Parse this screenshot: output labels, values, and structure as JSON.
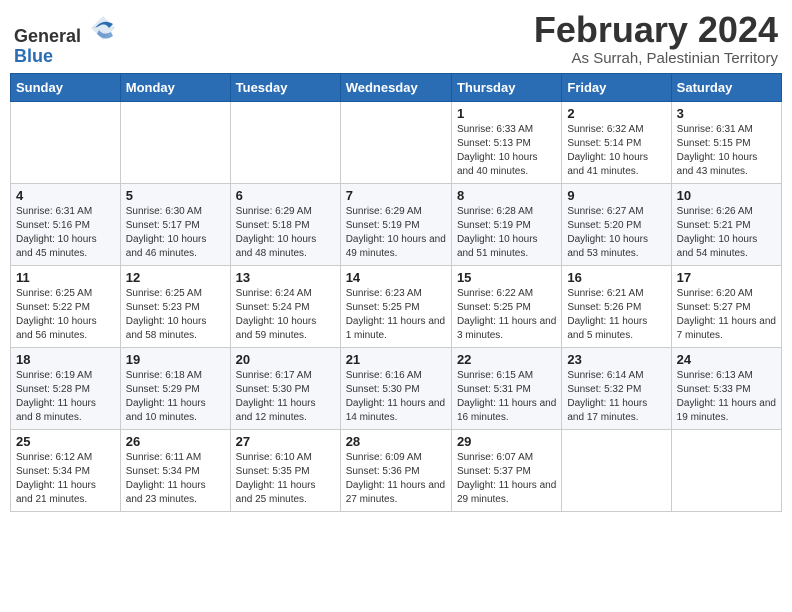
{
  "logo": {
    "general": "General",
    "blue": "Blue"
  },
  "header": {
    "month": "February 2024",
    "location": "As Surrah, Palestinian Territory"
  },
  "days_of_week": [
    "Sunday",
    "Monday",
    "Tuesday",
    "Wednesday",
    "Thursday",
    "Friday",
    "Saturday"
  ],
  "weeks": [
    [
      {
        "day": "",
        "sunrise": "",
        "sunset": "",
        "daylight": ""
      },
      {
        "day": "",
        "sunrise": "",
        "sunset": "",
        "daylight": ""
      },
      {
        "day": "",
        "sunrise": "",
        "sunset": "",
        "daylight": ""
      },
      {
        "day": "",
        "sunrise": "",
        "sunset": "",
        "daylight": ""
      },
      {
        "day": "1",
        "sunrise": "Sunrise: 6:33 AM",
        "sunset": "Sunset: 5:13 PM",
        "daylight": "Daylight: 10 hours and 40 minutes."
      },
      {
        "day": "2",
        "sunrise": "Sunrise: 6:32 AM",
        "sunset": "Sunset: 5:14 PM",
        "daylight": "Daylight: 10 hours and 41 minutes."
      },
      {
        "day": "3",
        "sunrise": "Sunrise: 6:31 AM",
        "sunset": "Sunset: 5:15 PM",
        "daylight": "Daylight: 10 hours and 43 minutes."
      }
    ],
    [
      {
        "day": "4",
        "sunrise": "Sunrise: 6:31 AM",
        "sunset": "Sunset: 5:16 PM",
        "daylight": "Daylight: 10 hours and 45 minutes."
      },
      {
        "day": "5",
        "sunrise": "Sunrise: 6:30 AM",
        "sunset": "Sunset: 5:17 PM",
        "daylight": "Daylight: 10 hours and 46 minutes."
      },
      {
        "day": "6",
        "sunrise": "Sunrise: 6:29 AM",
        "sunset": "Sunset: 5:18 PM",
        "daylight": "Daylight: 10 hours and 48 minutes."
      },
      {
        "day": "7",
        "sunrise": "Sunrise: 6:29 AM",
        "sunset": "Sunset: 5:19 PM",
        "daylight": "Daylight: 10 hours and 49 minutes."
      },
      {
        "day": "8",
        "sunrise": "Sunrise: 6:28 AM",
        "sunset": "Sunset: 5:19 PM",
        "daylight": "Daylight: 10 hours and 51 minutes."
      },
      {
        "day": "9",
        "sunrise": "Sunrise: 6:27 AM",
        "sunset": "Sunset: 5:20 PM",
        "daylight": "Daylight: 10 hours and 53 minutes."
      },
      {
        "day": "10",
        "sunrise": "Sunrise: 6:26 AM",
        "sunset": "Sunset: 5:21 PM",
        "daylight": "Daylight: 10 hours and 54 minutes."
      }
    ],
    [
      {
        "day": "11",
        "sunrise": "Sunrise: 6:25 AM",
        "sunset": "Sunset: 5:22 PM",
        "daylight": "Daylight: 10 hours and 56 minutes."
      },
      {
        "day": "12",
        "sunrise": "Sunrise: 6:25 AM",
        "sunset": "Sunset: 5:23 PM",
        "daylight": "Daylight: 10 hours and 58 minutes."
      },
      {
        "day": "13",
        "sunrise": "Sunrise: 6:24 AM",
        "sunset": "Sunset: 5:24 PM",
        "daylight": "Daylight: 10 hours and 59 minutes."
      },
      {
        "day": "14",
        "sunrise": "Sunrise: 6:23 AM",
        "sunset": "Sunset: 5:25 PM",
        "daylight": "Daylight: 11 hours and 1 minute."
      },
      {
        "day": "15",
        "sunrise": "Sunrise: 6:22 AM",
        "sunset": "Sunset: 5:25 PM",
        "daylight": "Daylight: 11 hours and 3 minutes."
      },
      {
        "day": "16",
        "sunrise": "Sunrise: 6:21 AM",
        "sunset": "Sunset: 5:26 PM",
        "daylight": "Daylight: 11 hours and 5 minutes."
      },
      {
        "day": "17",
        "sunrise": "Sunrise: 6:20 AM",
        "sunset": "Sunset: 5:27 PM",
        "daylight": "Daylight: 11 hours and 7 minutes."
      }
    ],
    [
      {
        "day": "18",
        "sunrise": "Sunrise: 6:19 AM",
        "sunset": "Sunset: 5:28 PM",
        "daylight": "Daylight: 11 hours and 8 minutes."
      },
      {
        "day": "19",
        "sunrise": "Sunrise: 6:18 AM",
        "sunset": "Sunset: 5:29 PM",
        "daylight": "Daylight: 11 hours and 10 minutes."
      },
      {
        "day": "20",
        "sunrise": "Sunrise: 6:17 AM",
        "sunset": "Sunset: 5:30 PM",
        "daylight": "Daylight: 11 hours and 12 minutes."
      },
      {
        "day": "21",
        "sunrise": "Sunrise: 6:16 AM",
        "sunset": "Sunset: 5:30 PM",
        "daylight": "Daylight: 11 hours and 14 minutes."
      },
      {
        "day": "22",
        "sunrise": "Sunrise: 6:15 AM",
        "sunset": "Sunset: 5:31 PM",
        "daylight": "Daylight: 11 hours and 16 minutes."
      },
      {
        "day": "23",
        "sunrise": "Sunrise: 6:14 AM",
        "sunset": "Sunset: 5:32 PM",
        "daylight": "Daylight: 11 hours and 17 minutes."
      },
      {
        "day": "24",
        "sunrise": "Sunrise: 6:13 AM",
        "sunset": "Sunset: 5:33 PM",
        "daylight": "Daylight: 11 hours and 19 minutes."
      }
    ],
    [
      {
        "day": "25",
        "sunrise": "Sunrise: 6:12 AM",
        "sunset": "Sunset: 5:34 PM",
        "daylight": "Daylight: 11 hours and 21 minutes."
      },
      {
        "day": "26",
        "sunrise": "Sunrise: 6:11 AM",
        "sunset": "Sunset: 5:34 PM",
        "daylight": "Daylight: 11 hours and 23 minutes."
      },
      {
        "day": "27",
        "sunrise": "Sunrise: 6:10 AM",
        "sunset": "Sunset: 5:35 PM",
        "daylight": "Daylight: 11 hours and 25 minutes."
      },
      {
        "day": "28",
        "sunrise": "Sunrise: 6:09 AM",
        "sunset": "Sunset: 5:36 PM",
        "daylight": "Daylight: 11 hours and 27 minutes."
      },
      {
        "day": "29",
        "sunrise": "Sunrise: 6:07 AM",
        "sunset": "Sunset: 5:37 PM",
        "daylight": "Daylight: 11 hours and 29 minutes."
      },
      {
        "day": "",
        "sunrise": "",
        "sunset": "",
        "daylight": ""
      },
      {
        "day": "",
        "sunrise": "",
        "sunset": "",
        "daylight": ""
      }
    ]
  ]
}
